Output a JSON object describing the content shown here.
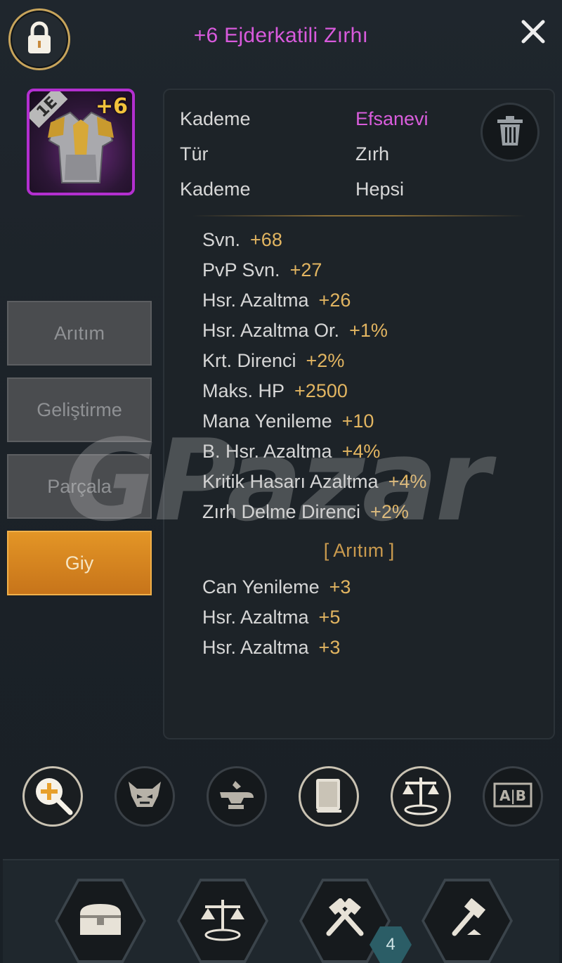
{
  "header": {
    "title": "+6 Ejderkatili Zırhı",
    "lock_icon": "padlock-icon",
    "close_icon": "close-icon"
  },
  "item": {
    "tier_badge": "1E",
    "enhance_level": "+6",
    "rarity_color": "#b32fd0"
  },
  "side_buttons": {
    "refine": "Arıtım",
    "upgrade": "Geliştirme",
    "dismantle": "Parçala",
    "equip": "Giy"
  },
  "info": {
    "rows": [
      {
        "label": "Kademe",
        "value": "Efsanevi"
      },
      {
        "label": "Tür",
        "value": "Zırh"
      },
      {
        "label": "Kademe",
        "value": "Hepsi"
      }
    ]
  },
  "stats": [
    {
      "name": "Svn.",
      "value": "+68"
    },
    {
      "name": "PvP Svn.",
      "value": "+27"
    },
    {
      "name": "Hsr. Azaltma",
      "value": "+26"
    },
    {
      "name": "Hsr. Azaltma Or.",
      "value": "+1%"
    },
    {
      "name": "Krt. Direnci",
      "value": "+2%"
    },
    {
      "name": "Maks. HP",
      "value": "+2500"
    },
    {
      "name": "Mana Yenileme",
      "value": "+10"
    },
    {
      "name": "B. Hsr. Azaltma",
      "value": "+4%"
    },
    {
      "name": "Kritik Hasarı Azaltma",
      "value": "+4%"
    },
    {
      "name": "Zırh Delme Direnci",
      "value": "+2%"
    }
  ],
  "refine_section": {
    "heading": "[ Arıtım ]",
    "stats": [
      {
        "name": "Can Yenileme",
        "value": "+3"
      },
      {
        "name": "Hsr. Azaltma",
        "value": "+5"
      },
      {
        "name": "Hsr. Azaltma",
        "value": "+3"
      }
    ]
  },
  "watermark": "GPazar",
  "action_icons": [
    "zoom-plus-icon",
    "demon-mask-icon",
    "anvil-icon",
    "book-icon",
    "scales-icon",
    "compare-ab-icon"
  ],
  "compare_label": "A|B",
  "bottom_nav": {
    "icons": [
      "chest-icon",
      "trade-scales-icon",
      "crossed-hammers-icon",
      "hammer-icon"
    ],
    "badge_count": "4"
  }
}
